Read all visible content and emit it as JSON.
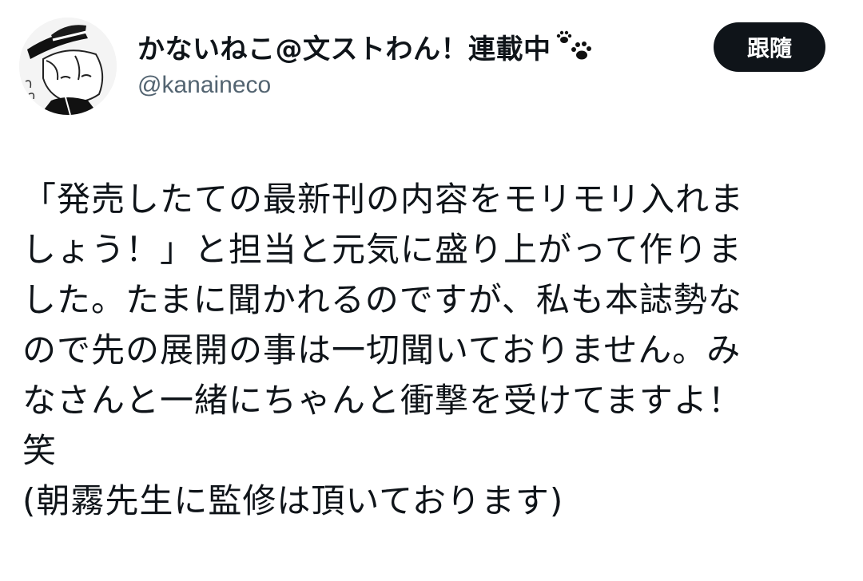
{
  "author": {
    "name": "かないねこ@文ストわん！連載中",
    "handle": "@kanaineco",
    "avatar_icon": "avatar-illustration",
    "name_icon": "paw-prints-icon"
  },
  "follow_button": {
    "label": "跟隨"
  },
  "tweet": {
    "lines": [
      "「発売したての最新刊の内容をモリモリ入れま",
      "しょう！」と担当と元気に盛り上がって作りま",
      "した。たまに聞かれるのですが、私も本誌勢な",
      "ので先の展開の事は一切聞いておりません。み",
      "なさんと一緒にちゃんと衝撃を受けてますよ！",
      "笑",
      "(朝霧先生に監修は頂いております)"
    ]
  },
  "colors": {
    "text": "#0f1419",
    "handle": "#536471",
    "button_bg": "#0f1419",
    "button_text": "#ffffff",
    "background": "#ffffff"
  }
}
